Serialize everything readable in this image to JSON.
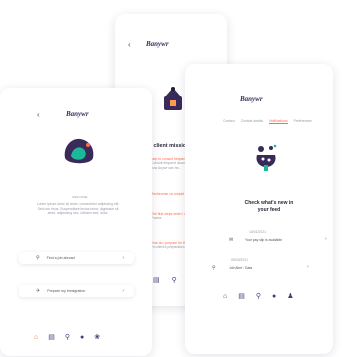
{
  "brand": {
    "logo": "Banywr"
  },
  "left_phone": {
    "logo": "Banywr",
    "back": "‹",
    "welcome_tag": "WELCOME",
    "body": "Lorem ipsum dolor sit amet, consectetur adipiscing elit. Sed non risus. Suspendisse lectus tortor, dignissim sit amet, adipiscing nec, ultricies sed, dolor.",
    "rows": [
      {
        "label": "Find a job abroad",
        "arrow": "›"
      },
      {
        "label": "Prepare my immigration",
        "arrow": "›"
      }
    ],
    "nav": [
      "home",
      "calendar",
      "search",
      "user",
      "leaf"
    ]
  },
  "center_phone": {
    "logo": "Banywr",
    "back": "‹",
    "title": "y client missio",
    "missions": [
      {
        "title": "step to consult frequen",
        "sub": "Consult frequent documents, feel how Anywr can he..."
      },
      {
        "title": "Rechercher un emploi",
        "sub": ""
      },
      {
        "title": "The first steps when i ar",
        "sub": "France"
      },
      {
        "title": "How do I prepare for th",
        "sub": "I'm client's preparation"
      }
    ],
    "nav": [
      "calendar",
      "search",
      "user"
    ]
  },
  "right_phone": {
    "logo": "Banywr",
    "tabs": [
      "Contact",
      "Contact details",
      "Notifications",
      "Preferences"
    ],
    "active_tab": "Notifications",
    "headline": "Check what's new in your feed",
    "date1": "10/01/2021",
    "item1": "Your pay slip is available",
    "date2": "05/03/2021",
    "item2": "Job Alert : Data",
    "nav": [
      "home",
      "calendar",
      "search",
      "user",
      "people"
    ]
  },
  "colors": {
    "accent": "#ff6b4a",
    "brand": "#3a2a5a",
    "teal": "#1bb89a"
  }
}
